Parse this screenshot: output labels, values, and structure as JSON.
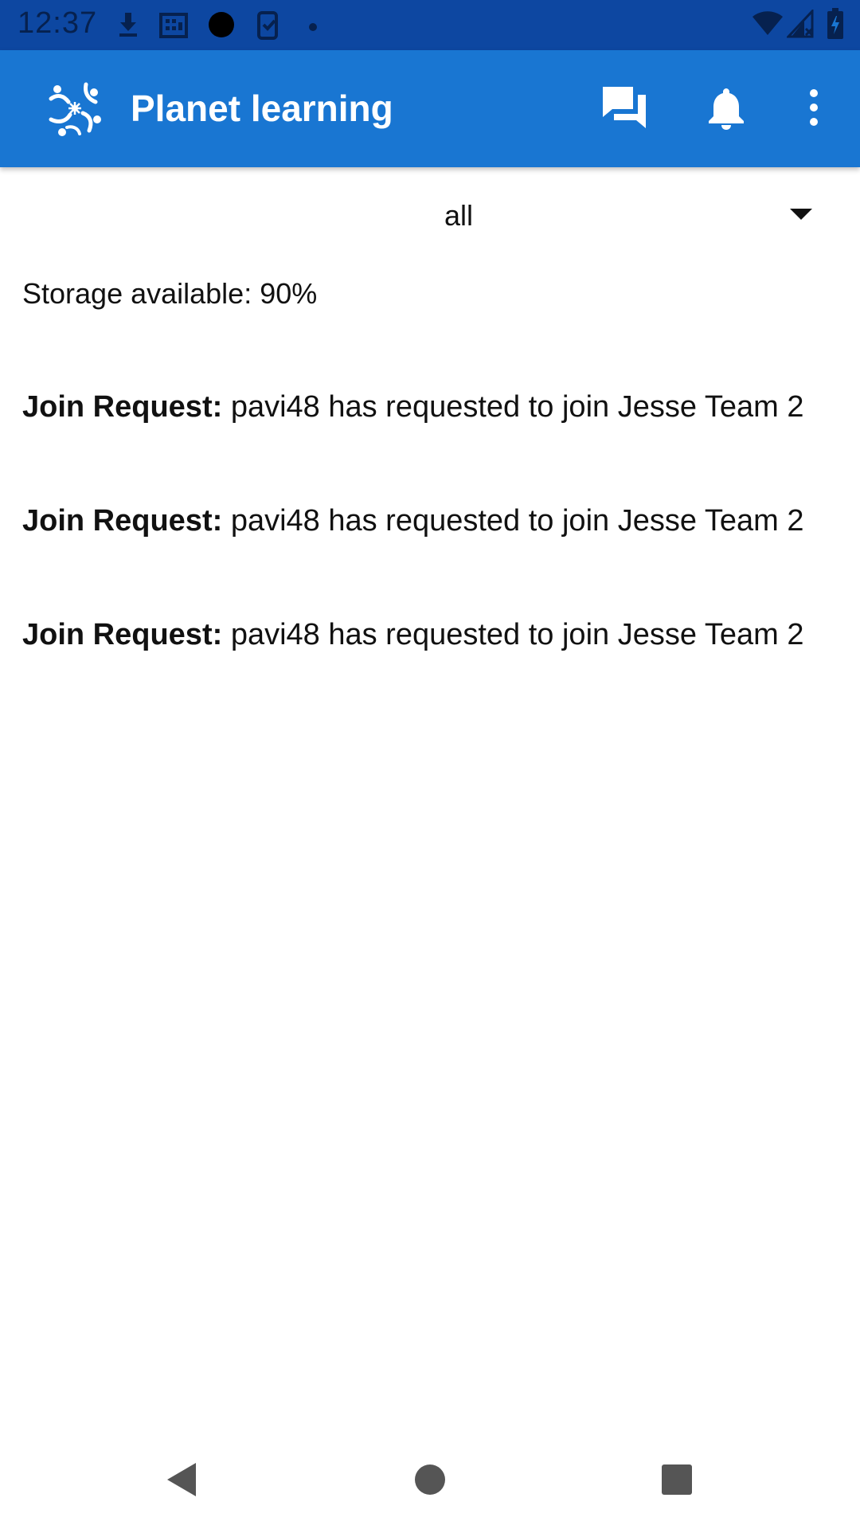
{
  "status_bar": {
    "time": "12:37",
    "left_icons": [
      "download-icon",
      "calendar-icon",
      "record-dot-icon",
      "device-check-icon",
      "small-dot-icon"
    ],
    "right_icons": [
      "wifi-icon",
      "signal-icon",
      "battery-charging-icon"
    ]
  },
  "app_bar": {
    "title": "Planet learning",
    "color": "#1976d2",
    "actions": [
      "chat-icon",
      "bell-icon",
      "more-vert-icon"
    ]
  },
  "filter": {
    "selected": "all"
  },
  "storage": {
    "text": "Storage available: 90%"
  },
  "notifications": [
    {
      "label": "Join Request:",
      "message": "pavi48 has requested to join Jesse Team 2"
    },
    {
      "label": "Join Request:",
      "message": "pavi48 has requested to join Jesse Team 2"
    },
    {
      "label": "Join Request:",
      "message": "pavi48 has requested to join Jesse Team 2"
    }
  ],
  "nav_bar": {
    "buttons": [
      "back-icon",
      "home-icon",
      "recents-icon"
    ]
  }
}
